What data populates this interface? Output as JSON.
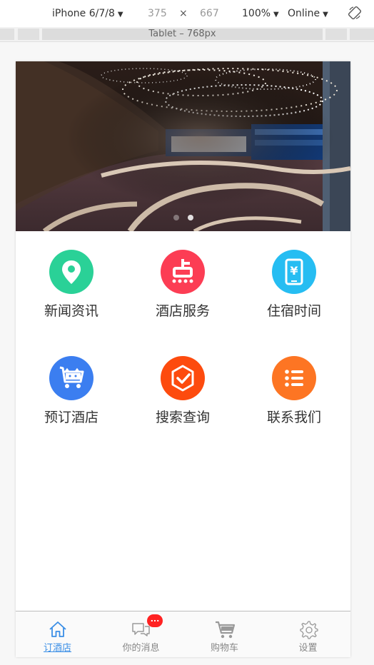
{
  "devtools": {
    "device_name": "iPhone 6/7/8",
    "width_value": "375",
    "times": "×",
    "height_value": "667",
    "zoom": "100%",
    "network": "Online",
    "media_query_label": "Tablet – 768px"
  },
  "banner": {
    "slides": 2,
    "active_slide": 1
  },
  "grid": [
    {
      "label": "新闻资讯",
      "icon": "location-pin-icon",
      "color": "#2ad197"
    },
    {
      "label": "酒店服务",
      "icon": "dianping-icon",
      "color": "#fc3d54"
    },
    {
      "label": "住宿时间",
      "icon": "phone-yen-icon",
      "color": "#26bdf2"
    },
    {
      "label": "预订酒店",
      "icon": "cart-cat-icon",
      "color": "#3b7ef0"
    },
    {
      "label": "搜索查询",
      "icon": "check-hexagon-icon",
      "color": "#fd4b0e"
    },
    {
      "label": "联系我们",
      "icon": "list-icon",
      "color": "#fd7523"
    }
  ],
  "tabbar": {
    "items": [
      {
        "label": "订酒店",
        "icon": "home-icon",
        "active": true
      },
      {
        "label": "你的消息",
        "icon": "chat-icon",
        "badge": "..."
      },
      {
        "label": "购物车",
        "icon": "cart-icon"
      },
      {
        "label": "设置",
        "icon": "gear-icon"
      }
    ]
  },
  "colors": {
    "active_tab": "#3a8ee6",
    "badge": "#ff2222"
  }
}
